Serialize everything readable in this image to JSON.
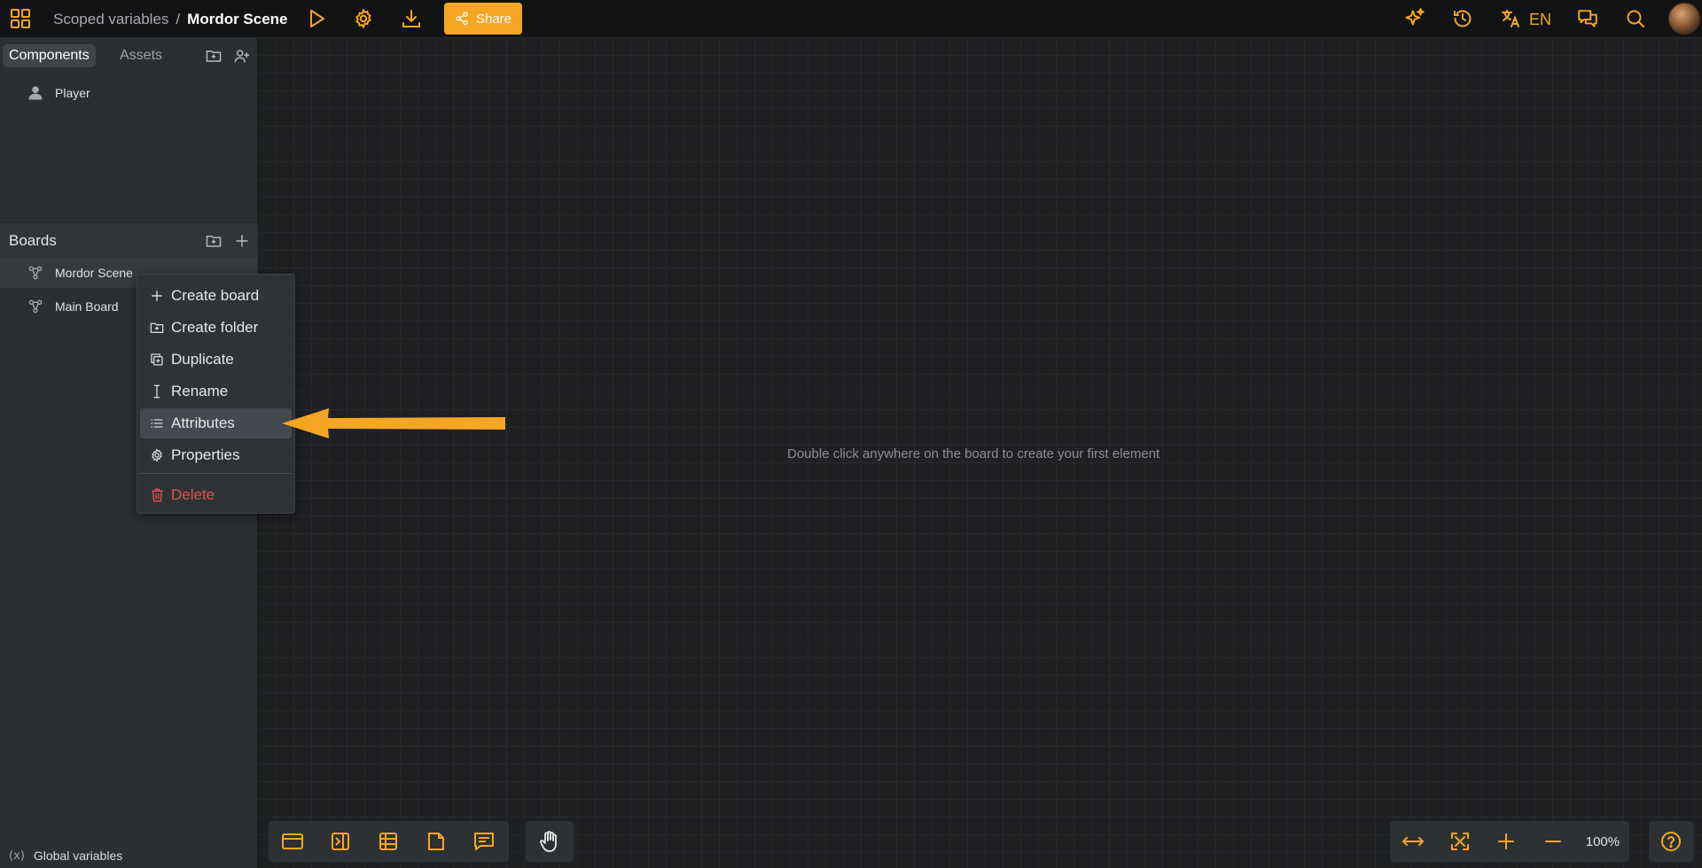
{
  "header": {
    "project_name": "Scoped variables",
    "separator": "/",
    "current_board": "Mordor Scene",
    "share_label": "Share",
    "language": "EN"
  },
  "sidebar": {
    "tabs": [
      {
        "label": "Components"
      },
      {
        "label": "Assets"
      }
    ],
    "components": [
      {
        "label": "Player",
        "icon": "user-icon"
      }
    ],
    "boards_title": "Boards",
    "boards": [
      {
        "label": "Mordor Scene",
        "icon": "board-graph-icon"
      },
      {
        "label": "Main Board",
        "icon": "board-graph-icon"
      }
    ],
    "global_variables_label": "Global variables",
    "global_variables_icon": "(x)"
  },
  "board": {
    "hint": "Double click anywhere on the board to create your first element"
  },
  "context_menu": {
    "items": [
      {
        "label": "Create board",
        "icon": "plus-icon"
      },
      {
        "label": "Create folder",
        "icon": "folder-plus-icon"
      },
      {
        "label": "Duplicate",
        "icon": "duplicate-icon"
      },
      {
        "label": "Rename",
        "icon": "text-cursor-icon"
      },
      {
        "label": "Attributes",
        "icon": "list-icon"
      },
      {
        "label": "Properties",
        "icon": "gear-icon"
      },
      {
        "label": "Delete",
        "icon": "trash-icon"
      }
    ]
  },
  "zoom": {
    "level": "100%"
  },
  "colors": {
    "accent": "#f6a623",
    "danger": "#e0524f",
    "sidebar_bg": "#2b2f32",
    "board_bg": "#1f2022"
  }
}
